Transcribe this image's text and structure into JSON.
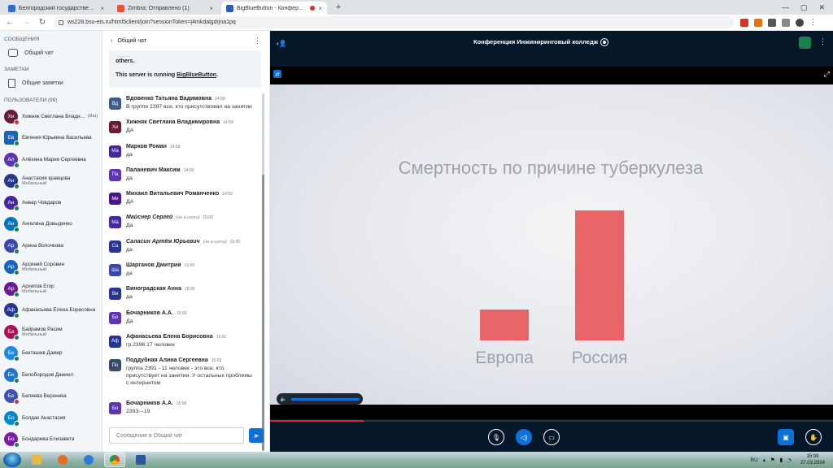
{
  "browser": {
    "tabs": [
      {
        "label": "Белгородский государственный",
        "favicon_color": "#2a6fc9",
        "active": false
      },
      {
        "label": "Zimbra: Отправлено (1)",
        "favicon_color": "#e5533d",
        "active": false
      },
      {
        "label": "BigBlueButton - Конференц",
        "favicon_color": "#2b5db8",
        "active": true,
        "recording": true
      }
    ],
    "new_tab_glyph": "+",
    "url": "ws228.bsu-eis.ru/html5client/join?sessionToken=j4mkdalgdrjna1pq"
  },
  "sidebar": {
    "messages_title": "СООБЩЕНИЯ",
    "public_chat": "Общий чат",
    "notes_title": "ЗАМЕТКИ",
    "shared_notes": "Общие заметки",
    "users_title": "ПОЛЬЗОВАТЕЛИ (99)",
    "users": [
      {
        "initials": "Хи",
        "name": "Хижняк Светлана Владимировна",
        "you": "(Вы)",
        "sub": "",
        "color": "#6a1b3a",
        "badge": "red",
        "square": false
      },
      {
        "initials": "Ев",
        "name": "Евгения Юрьевна Васильева",
        "you": "",
        "sub": "",
        "color": "#1565c0",
        "badge": "green",
        "square": true
      },
      {
        "initials": "Ал",
        "name": "Алёхина Мария Сергеевна",
        "you": "",
        "sub": "",
        "color": "#5e35b1",
        "badge": "green",
        "square": false
      },
      {
        "initials": "Ан",
        "name": "Анастасия кравцова",
        "you": "",
        "sub": "Мобильный",
        "color": "#283593",
        "badge": "green",
        "square": false
      },
      {
        "initials": "Ан",
        "name": "Анвар Човдаров",
        "you": "",
        "sub": "",
        "color": "#4527a0",
        "badge": "green",
        "square": false
      },
      {
        "initials": "Ан",
        "name": "Ангелина Довыденко",
        "you": "",
        "sub": "",
        "color": "#0277bd",
        "badge": "green",
        "square": false
      },
      {
        "initials": "Ар",
        "name": "Арина Волочкова",
        "you": "",
        "sub": "",
        "color": "#3949ab",
        "badge": "green",
        "square": false
      },
      {
        "initials": "Ар",
        "name": "Арсений Соровин",
        "you": "",
        "sub": "Мобильный",
        "color": "#1565c0",
        "badge": "green",
        "square": false
      },
      {
        "initials": "Ар",
        "name": "Архипов Егор",
        "you": "",
        "sub": "Мобильный",
        "color": "#6a1b9a",
        "badge": "green",
        "square": false
      },
      {
        "initials": "Аф",
        "name": "Афанасьева Елена Борисовна",
        "you": "",
        "sub": "",
        "color": "#283593",
        "badge": "green",
        "square": false
      },
      {
        "initials": "Ба",
        "name": "Байрамов Расим",
        "you": "",
        "sub": "Мобильный",
        "color": "#ad1457",
        "badge": "green",
        "square": false
      },
      {
        "initials": "Бе",
        "name": "Бекташев Дамир",
        "you": "",
        "sub": "",
        "color": "#1e88e5",
        "badge": "green",
        "square": false
      },
      {
        "initials": "Бе",
        "name": "Белобородов Даниил",
        "you": "",
        "sub": "",
        "color": "#1976d2",
        "badge": "green",
        "square": false
      },
      {
        "initials": "Бе",
        "name": "Беляева Вероника",
        "you": "",
        "sub": "",
        "color": "#3f51b5",
        "badge": "red",
        "square": false
      },
      {
        "initials": "Бо",
        "name": "Болдак Анастасия",
        "you": "",
        "sub": "",
        "color": "#0288d1",
        "badge": "green",
        "square": false
      },
      {
        "initials": "Бо",
        "name": "Бондарева Елизавета",
        "you": "",
        "sub": "",
        "color": "#7b1fa2",
        "badge": "green",
        "square": false
      }
    ]
  },
  "chat": {
    "back_label": "Общий чат",
    "more_glyph": "⋮",
    "welcome_line1": "others.",
    "welcome_line2_prefix": "This server is running ",
    "welcome_link": "BigBlueButton",
    "welcome_line2_suffix": ".",
    "input_placeholder": "Сообщение в Общий чат",
    "messages": [
      {
        "initials": "Вд",
        "color": "#3b5f8a",
        "name": "Вдовенко Татьяна Вадимовна",
        "time": "14:58",
        "offline": "",
        "italic": false,
        "text": "В группе 2397 все, кто присутствовал на занятии",
        "tall": false
      },
      {
        "initials": "Хи",
        "color": "#6a1b3a",
        "name": "Хижняк Светлана Владимировна",
        "time": "14:59",
        "offline": "",
        "italic": false,
        "text": "ДА",
        "tall": false
      },
      {
        "initials": "Ма",
        "color": "#4527a0",
        "name": "Марков Роман",
        "time": "14:59",
        "offline": "",
        "italic": false,
        "text": "да",
        "tall": false
      },
      {
        "initials": "Па",
        "color": "#5e35b1",
        "name": "Паланевич Максим",
        "time": "14:59",
        "offline": "",
        "italic": false,
        "text": "да",
        "tall": false
      },
      {
        "initials": "Ми",
        "color": "#4a148c",
        "name": "Михаил Витальевич Романченко",
        "time": "14:59",
        "offline": "",
        "italic": false,
        "text": "ДА",
        "tall": false
      },
      {
        "initials": "Ма",
        "color": "#4527a0",
        "name": "Майснер Сергей",
        "time": "15:00",
        "offline": "(не в сети)",
        "italic": true,
        "text": "Да",
        "tall": false
      },
      {
        "initials": "Са",
        "color": "#283593",
        "name": "Саласин Артём Юрьевич",
        "time": "15:00",
        "offline": "(не в сети)",
        "italic": true,
        "text": "да",
        "tall": false
      },
      {
        "initials": "Ша",
        "color": "#3949ab",
        "name": "Шарганов Дмитрий",
        "time": "15:00",
        "offline": "",
        "italic": false,
        "text": "да",
        "tall": false
      },
      {
        "initials": "Ви",
        "color": "#283593",
        "name": "Виноградская Анна",
        "time": "15:00",
        "offline": "",
        "italic": false,
        "text": "да",
        "tall": false
      },
      {
        "initials": "Бо",
        "color": "#5e35b1",
        "name": "Бочарников А.А.",
        "time": "15:00",
        "offline": "",
        "italic": false,
        "text": "Да",
        "tall": false
      },
      {
        "initials": "Аф",
        "color": "#283593",
        "name": "Афанасьева Елена Борисовна",
        "time": "15:01",
        "offline": "",
        "italic": false,
        "text": "гр.2396 17 человек",
        "tall": false
      },
      {
        "initials": "По",
        "color": "#3b4a6b",
        "name": "Поддубная Алина Сергеевна",
        "time": "15:03",
        "offline": "",
        "italic": false,
        "text": "группа 2391 - 11 человек - это все, кто присутствует на занятии. У остальных проблемы с интернетом",
        "tall": true
      },
      {
        "initials": "Бо",
        "color": "#5e35b1",
        "name": "Бочарников А.А.",
        "time": "15:06",
        "offline": "",
        "italic": false,
        "text": "2393---19",
        "tall": false
      }
    ]
  },
  "main": {
    "conference_title": "Конференция Инжиниринговый колледж",
    "slide": {
      "title": "Смертность по причине туберкулеза",
      "bar_color": "#e86466"
    },
    "volume_level": 1.0
  },
  "chart_data": {
    "type": "bar",
    "title": "Смертность по причине туберкулеза",
    "categories": [
      "Европа",
      "Россия"
    ],
    "values": [
      1,
      4.2
    ],
    "xlabel": "",
    "ylabel": "",
    "colors": [
      "#e86466",
      "#e86466"
    ]
  },
  "taskbar": {
    "lang": "RU",
    "time": "15:09",
    "date": "27.03.2024"
  }
}
